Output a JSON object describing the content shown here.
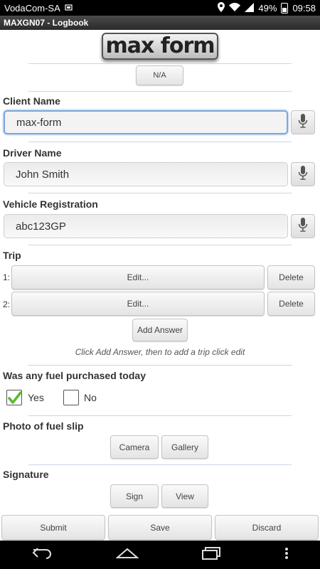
{
  "statusbar": {
    "carrier": "VodaCom-SA",
    "battery": "49%",
    "time": "09:58"
  },
  "app": {
    "title": "MAXGN07 - Logbook"
  },
  "logo": {
    "text": "max form"
  },
  "na_button": "N/A",
  "client": {
    "label": "Client Name",
    "value": "max-form"
  },
  "driver": {
    "label": "Driver Name",
    "value": "John Smith"
  },
  "vehicle": {
    "label": "Vehicle Registration",
    "value": "abc123GP"
  },
  "trip": {
    "label": "Trip",
    "rows": [
      {
        "num": "1:",
        "edit": "Edit...",
        "delete": "Delete"
      },
      {
        "num": "2:",
        "edit": "Edit...",
        "delete": "Delete"
      }
    ],
    "add_answer": "Add Answer",
    "hint": "Click Add Answer, then to add a trip click edit"
  },
  "fuel": {
    "label": "Was any fuel purchased today",
    "yes": "Yes",
    "no": "No",
    "yes_checked": true
  },
  "photo": {
    "label": "Photo of fuel slip",
    "camera": "Camera",
    "gallery": "Gallery"
  },
  "signature": {
    "label": "Signature",
    "sign": "Sign",
    "view": "View"
  },
  "footer": {
    "submit": "Submit",
    "save": "Save",
    "discard": "Discard"
  },
  "colors": {
    "focus_border": "#7da7d9",
    "check": "#5cb82e"
  }
}
